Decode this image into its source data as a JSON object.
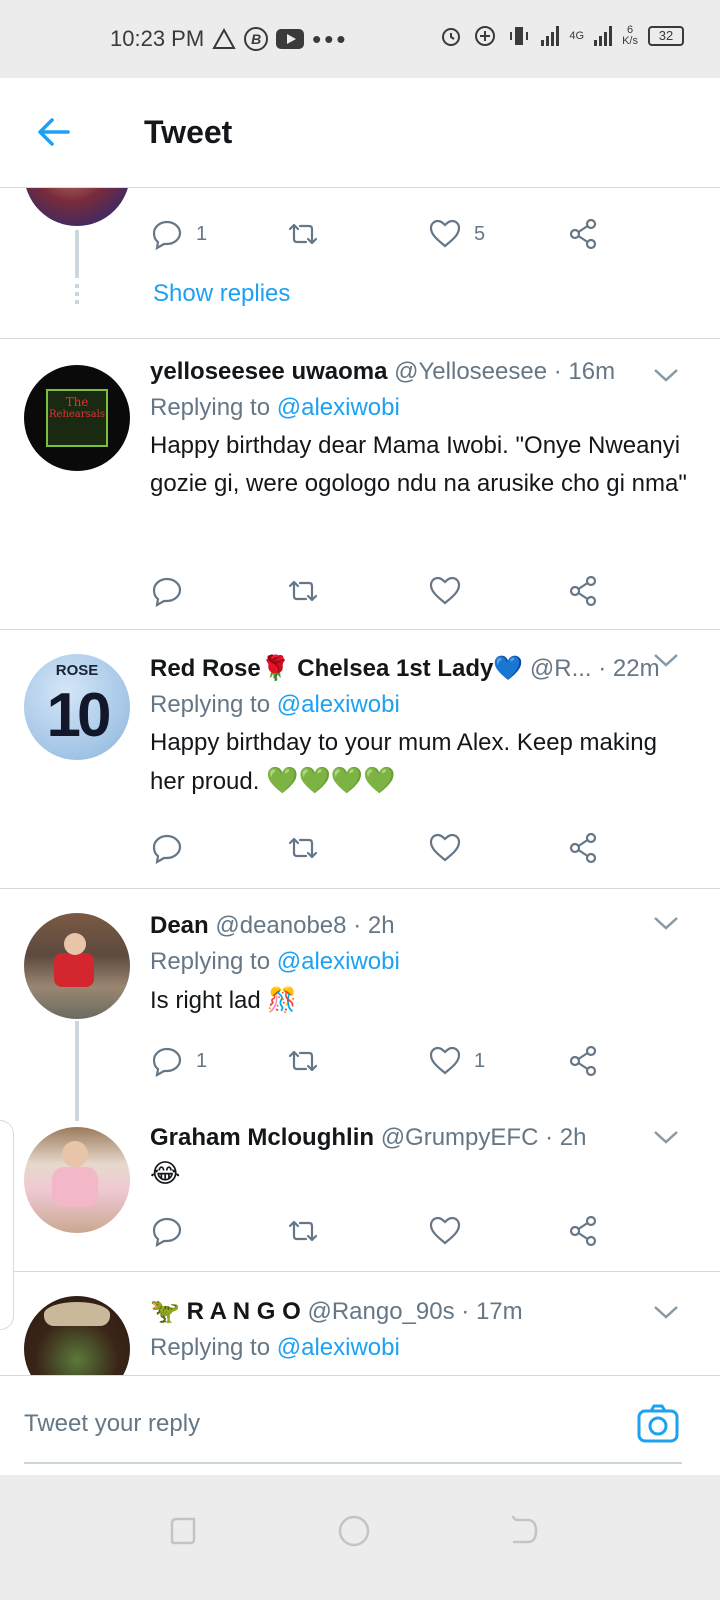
{
  "status_bar": {
    "time": "10:23 PM",
    "net_speed_value": "6",
    "net_speed_unit": "K/s",
    "network_type": "4G",
    "battery": "32"
  },
  "header": {
    "title": "Tweet"
  },
  "first_tweet": {
    "reply_count": "1",
    "like_count": "5",
    "show_replies": "Show replies"
  },
  "tweets": [
    {
      "name": "yelloseesee uwaoma",
      "handle": "@Yelloseesee",
      "time": "· 16m",
      "replying_prefix": "Replying to",
      "replying_to": "@alexiwobi",
      "text": "Happy birthday dear Mama Iwobi. \"Onye Nweanyi gozie gi, were ogologo ndu na arusike cho gi nma\"",
      "avatar_text_1": "The",
      "avatar_text_2": "Rehearsals",
      "reply_count": "",
      "like_count": ""
    },
    {
      "name": "Red Rose🌹 Chelsea 1st Lady💙",
      "handle": "@R...",
      "time": "· 22m",
      "replying_prefix": "Replying to",
      "replying_to": "@alexiwobi",
      "text": "Happy birthday to your mum Alex. Keep making her proud.",
      "emoji_hearts": "💚💚💚💚",
      "avatar_text_1": "ROSE",
      "avatar_text_2": "10",
      "reply_count": "",
      "like_count": ""
    },
    {
      "name": "Dean",
      "handle": "@deanobe8",
      "time": "· 2h",
      "replying_prefix": "Replying to",
      "replying_to": "@alexiwobi",
      "text": "Is right lad",
      "emoji": "🎊",
      "reply_count": "1",
      "like_count": "1"
    },
    {
      "name": "Graham Mcloughlin",
      "handle": "@GrumpyEFC",
      "time": "· 2h",
      "text": "😂",
      "reply_count": "",
      "like_count": ""
    },
    {
      "name_emoji": "🦖",
      "name": "R A N G O",
      "handle": "@Rango_90s",
      "time": "· 17m",
      "replying_prefix": "Replying to",
      "replying_to": "@alexiwobi"
    }
  ],
  "reply_bar": {
    "placeholder": "Tweet your reply"
  },
  "colors": {
    "accent": "#1da1f2",
    "secondary_text": "#657786",
    "divider": "#d9d9d9"
  }
}
